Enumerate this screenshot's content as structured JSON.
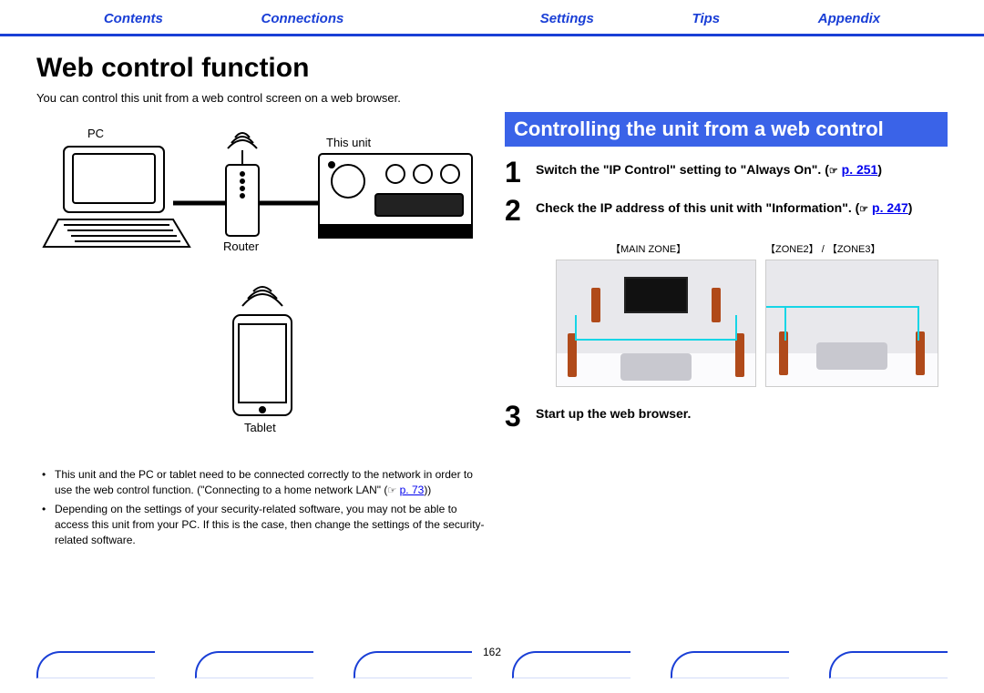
{
  "nav": {
    "contents": "Contents",
    "connections": "Connections",
    "playback": "",
    "settings": "Settings",
    "tips": "Tips",
    "appendix": "Appendix"
  },
  "title": "Web control function",
  "intro": "You can control this unit from a web control screen on a web browser.",
  "diagram": {
    "pc": "PC",
    "router": "Router",
    "this_unit": "This unit",
    "tablet": "Tablet"
  },
  "notes": {
    "n1a": "This unit and the PC or tablet need to be connected correctly to the network in order to use the web control function. (\"Connecting to a home network LAN\" (",
    "n1link": "p. 73",
    "n1b": "))",
    "n2": "Depending on the settings of your security-related software, you may not be able to access this unit from your PC. If this is the case, then change the settings of the security-related software."
  },
  "subheader": "Controlling the unit from a web control",
  "steps": {
    "s1num": "1",
    "s1a": "Switch the \"IP Control\" setting to \"Always On\". (",
    "s1link": "p. 251",
    "s1b": ")",
    "s2num": "2",
    "s2a": "Check the IP address of this unit with \"Information\". (",
    "s2link": "p. 247",
    "s2b": ")",
    "s3num": "3",
    "s3": "Start up the web browser."
  },
  "zones": {
    "main": "【MAIN ZONE】",
    "z23": "【ZONE2】 / 【ZONE3】"
  },
  "pagenum": "162",
  "hand_glyph": "☞"
}
